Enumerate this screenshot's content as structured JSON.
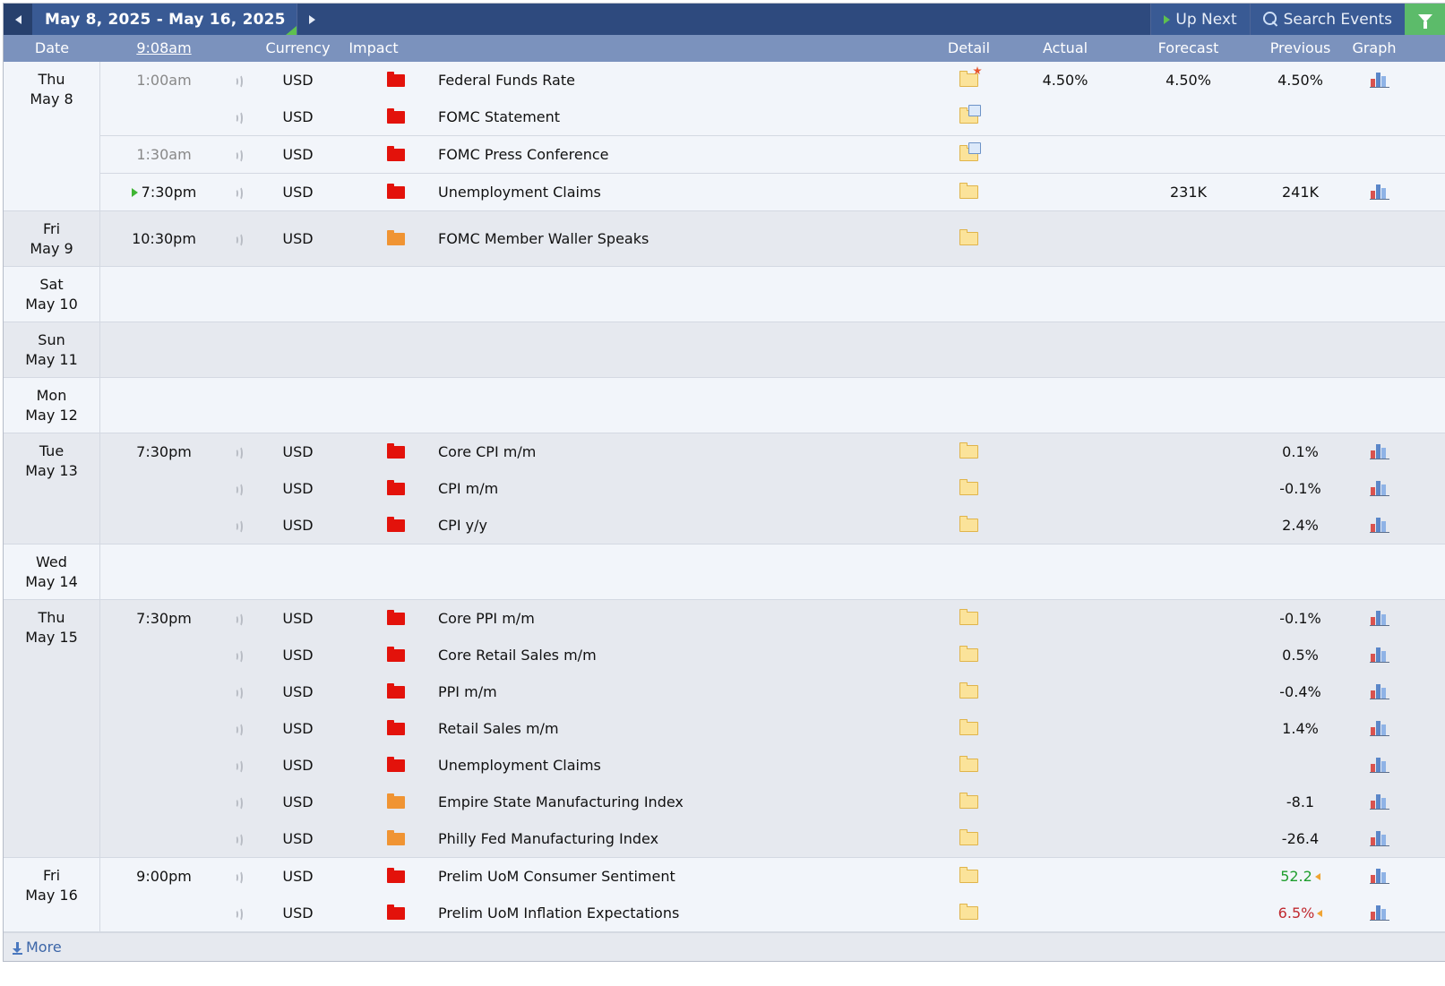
{
  "topbar": {
    "date_range": "May 8, 2025 - May 16, 2025",
    "up_next_label": "Up Next",
    "search_label": "Search Events"
  },
  "header": {
    "date": "Date",
    "time": "9:08am",
    "currency": "Currency",
    "impact": "Impact",
    "detail": "Detail",
    "actual": "Actual",
    "forecast": "Forecast",
    "previous": "Previous",
    "graph": "Graph"
  },
  "days": [
    {
      "dow": "Thu",
      "date": "May 8",
      "events": [
        {
          "time": "1:00am",
          "currency": "USD",
          "impact": "high",
          "title": "Federal Funds Rate",
          "actual": "4.50%",
          "forecast": "4.50%",
          "previous": "4.50%",
          "detail_icon": "folder-star-icon",
          "graph": true
        },
        {
          "time": "",
          "currency": "USD",
          "impact": "high",
          "title": "FOMC Statement",
          "actual": "",
          "forecast": "",
          "previous": "",
          "detail_icon": "folder-doc-icon",
          "graph": false
        },
        {
          "time": "1:30am",
          "currency": "USD",
          "impact": "high",
          "title": "FOMC Press Conference",
          "actual": "",
          "forecast": "",
          "previous": "",
          "detail_icon": "folder-doc-icon",
          "graph": false
        },
        {
          "time": "7:30pm",
          "currency": "USD",
          "impact": "high",
          "title": "Unemployment Claims",
          "actual": "",
          "forecast": "231K",
          "previous": "241K",
          "detail_icon": "folder-icon",
          "graph": true
        }
      ]
    },
    {
      "dow": "Fri",
      "date": "May 9",
      "events": [
        {
          "time": "10:30pm",
          "currency": "USD",
          "impact": "medium",
          "title": "FOMC Member Waller Speaks",
          "actual": "",
          "forecast": "",
          "previous": "",
          "detail_icon": "folder-icon",
          "graph": false
        }
      ]
    },
    {
      "dow": "Sat",
      "date": "May 10",
      "events": []
    },
    {
      "dow": "Sun",
      "date": "May 11",
      "events": []
    },
    {
      "dow": "Mon",
      "date": "May 12",
      "events": []
    },
    {
      "dow": "Tue",
      "date": "May 13",
      "events": [
        {
          "time": "7:30pm",
          "currency": "USD",
          "impact": "high",
          "title": "Core CPI m/m",
          "actual": "",
          "forecast": "",
          "previous": "0.1%",
          "detail_icon": "folder-icon",
          "graph": true
        },
        {
          "time": "",
          "currency": "USD",
          "impact": "high",
          "title": "CPI m/m",
          "actual": "",
          "forecast": "",
          "previous": "-0.1%",
          "detail_icon": "folder-icon",
          "graph": true
        },
        {
          "time": "",
          "currency": "USD",
          "impact": "high",
          "title": "CPI y/y",
          "actual": "",
          "forecast": "",
          "previous": "2.4%",
          "detail_icon": "folder-icon",
          "graph": true
        }
      ]
    },
    {
      "dow": "Wed",
      "date": "May 14",
      "events": []
    },
    {
      "dow": "Thu",
      "date": "May 15",
      "events": [
        {
          "time": "7:30pm",
          "currency": "USD",
          "impact": "high",
          "title": "Core PPI m/m",
          "actual": "",
          "forecast": "",
          "previous": "-0.1%",
          "detail_icon": "folder-icon",
          "graph": true
        },
        {
          "time": "",
          "currency": "USD",
          "impact": "high",
          "title": "Core Retail Sales m/m",
          "actual": "",
          "forecast": "",
          "previous": "0.5%",
          "detail_icon": "folder-icon",
          "graph": true
        },
        {
          "time": "",
          "currency": "USD",
          "impact": "high",
          "title": "PPI m/m",
          "actual": "",
          "forecast": "",
          "previous": "-0.4%",
          "detail_icon": "folder-icon",
          "graph": true
        },
        {
          "time": "",
          "currency": "USD",
          "impact": "high",
          "title": "Retail Sales m/m",
          "actual": "",
          "forecast": "",
          "previous": "1.4%",
          "detail_icon": "folder-icon",
          "graph": true
        },
        {
          "time": "",
          "currency": "USD",
          "impact": "high",
          "title": "Unemployment Claims",
          "actual": "",
          "forecast": "",
          "previous": "",
          "detail_icon": "folder-icon",
          "graph": true
        },
        {
          "time": "",
          "currency": "USD",
          "impact": "medium",
          "title": "Empire State Manufacturing Index",
          "actual": "",
          "forecast": "",
          "previous": "-8.1",
          "detail_icon": "folder-icon",
          "graph": true
        },
        {
          "time": "",
          "currency": "USD",
          "impact": "medium",
          "title": "Philly Fed Manufacturing Index",
          "actual": "",
          "forecast": "",
          "previous": "-26.4",
          "detail_icon": "folder-icon",
          "graph": true
        }
      ]
    },
    {
      "dow": "Fri",
      "date": "May 16",
      "events": [
        {
          "time": "9:00pm",
          "currency": "USD",
          "impact": "high",
          "title": "Prelim UoM Consumer Sentiment",
          "actual": "",
          "forecast": "",
          "previous": "52.2",
          "previous_status": "better",
          "detail_icon": "folder-icon",
          "graph": true
        },
        {
          "time": "",
          "currency": "USD",
          "impact": "high",
          "title": "Prelim UoM Inflation Expectations",
          "actual": "",
          "forecast": "",
          "previous": "6.5%",
          "previous_status": "worse",
          "detail_icon": "folder-icon",
          "graph": true
        }
      ]
    }
  ],
  "footer": {
    "more_label": "More"
  },
  "colors": {
    "high_impact": "#e3120b",
    "medium_impact": "#f09433",
    "header_bg": "#7b92bd",
    "topbar_bg": "#2e4a7e"
  }
}
